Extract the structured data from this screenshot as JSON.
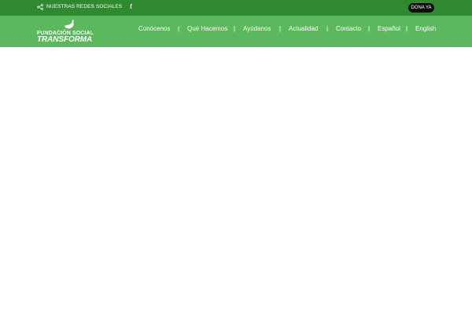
{
  "topbar": {
    "social_label": "NUESTRAS REDES SOCIALES",
    "facebook_glyph": "f",
    "donate_label": "DONA YA"
  },
  "logo": {
    "line1": "FUNDACIÓN SOCIAL",
    "line2": "TRANSFORMA"
  },
  "nav": {
    "items": [
      "Conócenos",
      "Qué Hacemos",
      "Ayúdanos",
      "Actualidad",
      "Contacto",
      "Español",
      "English"
    ],
    "separator": "|"
  },
  "colors": {
    "topbar": "#2f8a2f",
    "mainbar": "#5cb85c",
    "donate": "#0d0d0d"
  }
}
